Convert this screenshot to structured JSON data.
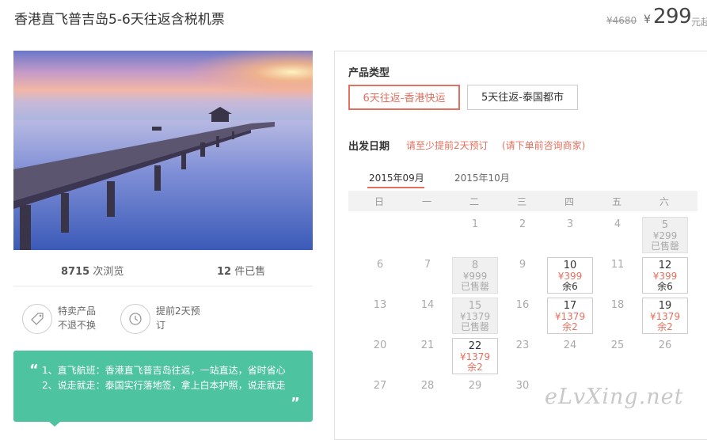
{
  "header": {
    "title": "香港直飞普吉岛5-6天往返含税机票",
    "original_price": "¥4680",
    "currency_symbol": "¥",
    "price": "299",
    "price_unit": "元起"
  },
  "stats": {
    "views_count": "8715",
    "views_label": "次浏览",
    "sold_count": "12",
    "sold_label": "件已售"
  },
  "features": [
    {
      "icon": "tag-icon",
      "line1": "特卖产品",
      "line2": "不退不换"
    },
    {
      "icon": "clock-icon",
      "line1": "提前2天预",
      "line2": "订"
    }
  ],
  "quote": {
    "line1": "1、直飞航班：香港直飞普吉岛往返，一站直达，省时省心",
    "line2": "2、说走就走：泰国实行落地签，拿上白本护照，说走就走",
    "open_mark": "“",
    "close_mark": "”"
  },
  "product": {
    "label": "产品类型",
    "options": [
      {
        "label": "6天往返-香港快运",
        "selected": true
      },
      {
        "label": "5天往返-泰国都市",
        "selected": false
      }
    ]
  },
  "departure": {
    "label": "出发日期",
    "notice1": "请至少提前2天预订",
    "notice2": "(请下单前咨询商家)"
  },
  "calendar": {
    "months": [
      {
        "label": "2015年09月",
        "active": true
      },
      {
        "label": "2015年10月",
        "active": false
      }
    ],
    "weekdays": [
      "日",
      "一",
      "二",
      "三",
      "四",
      "五",
      "六"
    ],
    "rows": [
      [
        "",
        "",
        "1",
        "2",
        "3",
        "4",
        "5"
      ],
      [
        "6",
        "7",
        "8",
        "9",
        "10",
        "11",
        "12"
      ],
      [
        "13",
        "14",
        "15",
        "16",
        "17",
        "18",
        "19"
      ],
      [
        "20",
        "21",
        "22",
        "23",
        "24",
        "25",
        "26"
      ],
      [
        "27",
        "28",
        "29",
        "30",
        "",
        "",
        ""
      ]
    ],
    "cells": {
      "d5": {
        "price": "¥299",
        "status": "已售罄"
      },
      "d8": {
        "price": "¥999",
        "status": "已售罄"
      },
      "d10": {
        "price": "¥399",
        "status": "余6"
      },
      "d12": {
        "price": "¥399",
        "status": "余6"
      },
      "d15": {
        "price": "¥1379",
        "status": "已售罄"
      },
      "d17": {
        "price": "¥1379",
        "status": "余2"
      },
      "d19": {
        "price": "¥1379",
        "status": "余2"
      },
      "d22": {
        "price": "¥1379",
        "status": "余2"
      }
    }
  },
  "watermark": "eLvXing.net",
  "colors": {
    "accent": "#e4705f",
    "quote_bg": "#4dc3a0"
  }
}
